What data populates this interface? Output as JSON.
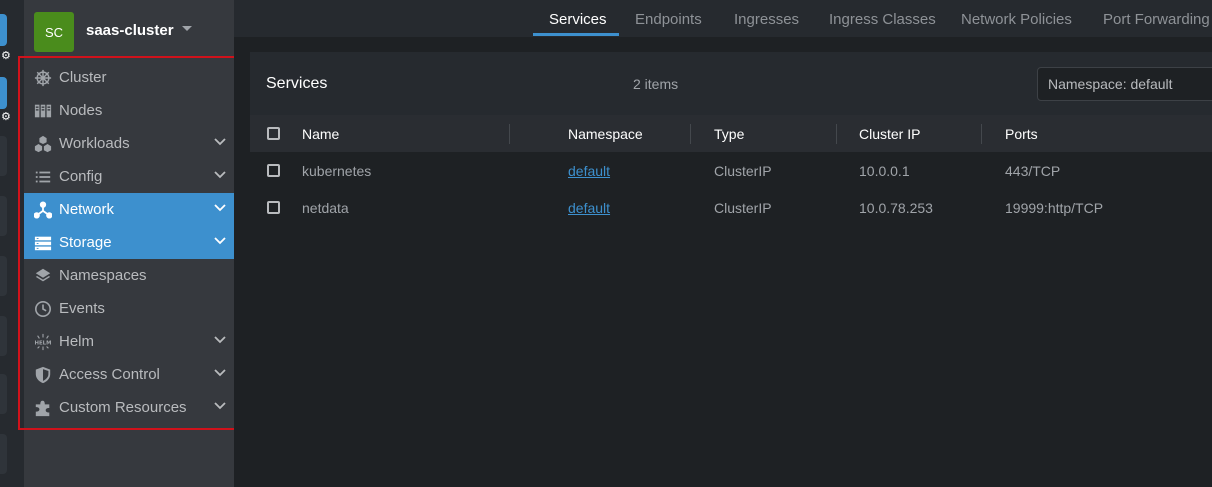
{
  "cluster": {
    "initials": "SC",
    "name": "saas-cluster",
    "avatar_color": "#4a8c1c"
  },
  "sidebar": {
    "items": [
      {
        "label": "Cluster",
        "icon": "helm-wheel-icon",
        "expandable": false,
        "active": false
      },
      {
        "label": "Nodes",
        "icon": "nodes-icon",
        "expandable": false,
        "active": false
      },
      {
        "label": "Workloads",
        "icon": "workloads-icon",
        "expandable": true,
        "active": false
      },
      {
        "label": "Config",
        "icon": "list-icon",
        "expandable": true,
        "active": false
      },
      {
        "label": "Network",
        "icon": "network-icon",
        "expandable": true,
        "active": true
      },
      {
        "label": "Storage",
        "icon": "storage-icon",
        "expandable": true,
        "active": true
      },
      {
        "label": "Namespaces",
        "icon": "layers-icon",
        "expandable": false,
        "active": false
      },
      {
        "label": "Events",
        "icon": "clock-icon",
        "expandable": false,
        "active": false
      },
      {
        "label": "Helm",
        "icon": "helm-icon",
        "expandable": true,
        "active": false
      },
      {
        "label": "Access Control",
        "icon": "shield-icon",
        "expandable": true,
        "active": false
      },
      {
        "label": "Custom Resources",
        "icon": "puzzle-icon",
        "expandable": true,
        "active": false
      }
    ]
  },
  "tabs": [
    {
      "label": "Services",
      "active": true
    },
    {
      "label": "Endpoints",
      "active": false
    },
    {
      "label": "Ingresses",
      "active": false
    },
    {
      "label": "Ingress Classes",
      "active": false
    },
    {
      "label": "Network Policies",
      "active": false
    },
    {
      "label": "Port Forwarding",
      "active": false
    }
  ],
  "main": {
    "title": "Services",
    "item_count": "2 items",
    "namespace_select": "Namespace: default"
  },
  "table": {
    "columns": [
      "Name",
      "Namespace",
      "Type",
      "Cluster IP",
      "Ports"
    ],
    "rows": [
      {
        "name": "kubernetes",
        "namespace": "default",
        "type": "ClusterIP",
        "cluster_ip": "10.0.0.1",
        "ports": "443/TCP"
      },
      {
        "name": "netdata",
        "namespace": "default",
        "type": "ClusterIP",
        "cluster_ip": "10.0.78.253",
        "ports": "19999:http/TCP"
      }
    ]
  },
  "colors": {
    "accent": "#3d90ce",
    "highlight": "#d0121b",
    "sidebar_bg": "#36393e",
    "content_bg": "#1e2124"
  }
}
